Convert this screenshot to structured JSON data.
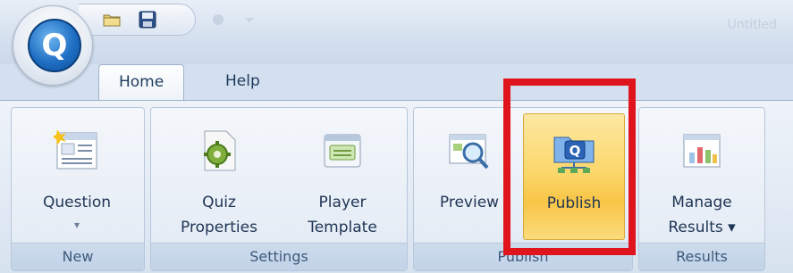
{
  "app": {
    "logo_letter": "Q"
  },
  "titlebar": {
    "faint_title": "Untitled"
  },
  "tabs": [
    {
      "label": "Home"
    },
    {
      "label": "Help"
    }
  ],
  "ribbon": {
    "groups": {
      "new": {
        "label": "New",
        "question": {
          "line1": "Question",
          "line2": "▾"
        }
      },
      "settings": {
        "label": "Settings",
        "quiz_properties": {
          "line1": "Quiz",
          "line2": "Properties"
        },
        "player_template": {
          "line1": "Player",
          "line2": "Template"
        }
      },
      "publish": {
        "label": "Publish",
        "preview": {
          "line1": "Preview"
        },
        "publish": {
          "line1": "Publish"
        }
      },
      "results": {
        "label": "Results",
        "manage_results": {
          "line1": "Manage",
          "line2": "Results ▾"
        }
      }
    }
  },
  "colors": {
    "highlight": "#e0141c",
    "active_button": "#f8c546",
    "logo": "#1f6fc4"
  }
}
